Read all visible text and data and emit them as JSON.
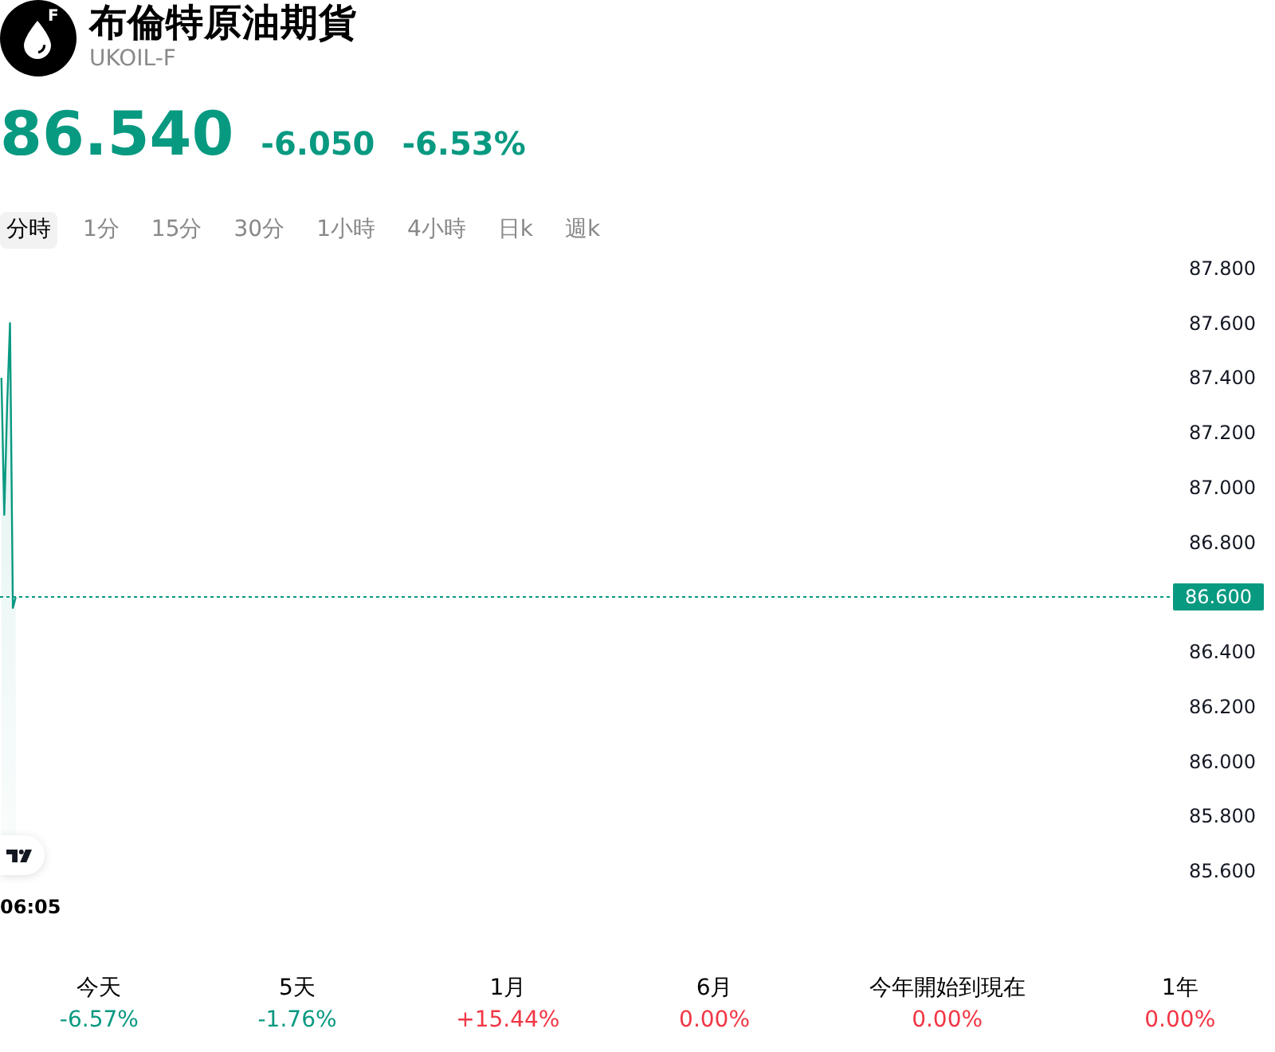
{
  "header": {
    "logo_letter": "F",
    "title": "布倫特原油期貨",
    "symbol": "UKOIL-F"
  },
  "quote": {
    "price": "86.540",
    "change": "-6.050",
    "change_percent": "-6.53%",
    "color": "#089981"
  },
  "tabs": [
    {
      "label": "分時",
      "selected": true
    },
    {
      "label": "1分",
      "selected": false
    },
    {
      "label": "15分",
      "selected": false
    },
    {
      "label": "30分",
      "selected": false
    },
    {
      "label": "1小時",
      "selected": false
    },
    {
      "label": "4小時",
      "selected": false
    },
    {
      "label": "日k",
      "selected": false
    },
    {
      "label": "週k",
      "selected": false
    }
  ],
  "chart": {
    "chart_data": {
      "type": "area",
      "categories": [
        null,
        null,
        null,
        null,
        null,
        null,
        null,
        null,
        null,
        null,
        null,
        null,
        null,
        null,
        null,
        null,
        null,
        null,
        null,
        null,
        null,
        null,
        null,
        null,
        null,
        null,
        null,
        null,
        null,
        null,
        null,
        null,
        null,
        null,
        null,
        null,
        null,
        null,
        null,
        null,
        null,
        null,
        null,
        null,
        null,
        null,
        null,
        null,
        null,
        null,
        null,
        null,
        null,
        null,
        null,
        null,
        null,
        null,
        null,
        null,
        null,
        null,
        null,
        null,
        null,
        null,
        null,
        null,
        null,
        null,
        null,
        null,
        null,
        null,
        null,
        null,
        null,
        null,
        null,
        null,
        null,
        null,
        null,
        null,
        null,
        null,
        null,
        null,
        null,
        null,
        null,
        null,
        null,
        null,
        null,
        null,
        null,
        null,
        null,
        null,
        null,
        null,
        null,
        null,
        null,
        null,
        null,
        null,
        null,
        null,
        null,
        null,
        null,
        null,
        null,
        null,
        null,
        null,
        null,
        null,
        null,
        null,
        null,
        null,
        null,
        null,
        null,
        null,
        null,
        null,
        null,
        null,
        null,
        null,
        null,
        null,
        null,
        null,
        null,
        null,
        null,
        null,
        null,
        null,
        null,
        null,
        null,
        null,
        null,
        null,
        null,
        null,
        null,
        null,
        null,
        null,
        null,
        null,
        null,
        null,
        null,
        null,
        null,
        null,
        null,
        null,
        null,
        null,
        null,
        null,
        null,
        null,
        null,
        null,
        null,
        null,
        null,
        null,
        null,
        null,
        null,
        null,
        null,
        null,
        null,
        null,
        null,
        null,
        null,
        null,
        null,
        null,
        null,
        null,
        null,
        null,
        null,
        null,
        null,
        null,
        null,
        null,
        null,
        null,
        null,
        null,
        null,
        null,
        null,
        null,
        null,
        null,
        null,
        null,
        null,
        null,
        null,
        null,
        null,
        null,
        null,
        null,
        null,
        null,
        null,
        null,
        null,
        null,
        null,
        null,
        null,
        null,
        null,
        null,
        null,
        null,
        null,
        null,
        null,
        null,
        null,
        null,
        null,
        null,
        null,
        null,
        null,
        null,
        null,
        null,
        null,
        null,
        null,
        null,
        null,
        null,
        null,
        null,
        null,
        null,
        null,
        null,
        null,
        null,
        null,
        null,
        null,
        null,
        null,
        null,
        null,
        null,
        null,
        null,
        null,
        null,
        null,
        null,
        null,
        null,
        null,
        null,
        null,
        null,
        null,
        null,
        null,
        null,
        null,
        null,
        null,
        null,
        null,
        null,
        null,
        null,
        null,
        null,
        null,
        null,
        null,
        null,
        null,
        null,
        null,
        null,
        null,
        null,
        null,
        null,
        null,
        null,
        null,
        null,
        null,
        null,
        null,
        null,
        null,
        null,
        null,
        null,
        null,
        null,
        null,
        null,
        null,
        null,
        null,
        null,
        null,
        null,
        null,
        null,
        null,
        null,
        null,
        null,
        null,
        null,
        null,
        null,
        null,
        null,
        null,
        null,
        null,
        null,
        null,
        null,
        null,
        null,
        null,
        null,
        null,
        null,
        null,
        null,
        null,
        null,
        null,
        null,
        null,
        null,
        null,
        null,
        null,
        null,
        null,
        null,
        null,
        null,
        null,
        null,
        null,
        null,
        null,
        null,
        null,
        null,
        null,
        null,
        null,
        null,
        null,
        null,
        null,
        null,
        null,
        null,
        null,
        null,
        null,
        null,
        null,
        null,
        null,
        null,
        null,
        null,
        null,
        null,
        null,
        null,
        null,
        null,
        null,
        null,
        null,
        null
      ],
      "ylim": [
        85.6,
        87.8
      ],
      "series": [
        {
          "color": "#089981",
          "values": [
            87.4,
            86.9,
            87.3,
            87.6,
            86.56,
            86.6,
            null,
            null,
            null,
            null,
            null,
            null,
            null,
            null,
            null,
            null,
            null,
            null,
            null,
            null,
            null,
            null,
            null,
            null,
            null,
            null,
            null,
            null,
            null,
            null,
            null,
            null,
            null,
            null,
            null,
            null,
            null,
            null,
            null,
            null,
            null,
            null,
            null,
            null,
            null,
            null,
            null,
            null,
            null,
            null,
            null,
            null,
            null,
            null,
            null,
            null,
            null,
            null,
            null,
            null,
            null,
            null,
            null,
            null,
            null,
            null,
            null,
            null,
            null,
            null,
            null,
            null,
            null,
            null,
            null,
            null,
            null,
            null,
            null,
            null,
            null,
            null,
            null,
            null,
            null,
            null,
            null,
            null,
            null,
            null,
            null,
            null,
            null,
            null,
            null,
            null,
            null,
            null,
            null,
            null,
            null,
            null,
            null,
            null,
            null,
            null,
            null,
            null,
            null,
            null,
            null,
            null,
            null,
            null,
            null,
            null,
            null,
            null,
            null,
            null,
            null,
            null,
            null,
            null,
            null,
            null,
            null,
            null,
            null,
            null,
            null,
            null,
            null,
            null,
            null,
            null,
            null,
            null,
            null,
            null,
            null,
            null,
            null,
            null,
            null,
            null,
            null,
            null,
            null,
            null,
            null,
            null,
            null,
            null,
            null,
            null,
            null,
            null,
            null,
            null,
            null,
            null,
            null,
            null,
            null,
            null,
            null,
            null,
            null,
            null,
            null,
            null,
            null,
            null,
            null,
            null,
            null,
            null,
            null,
            null,
            null,
            null,
            null,
            null,
            null,
            null,
            null,
            null,
            null,
            null,
            null,
            null,
            null,
            null,
            null,
            null,
            null,
            null,
            null,
            null,
            null,
            null,
            null,
            null,
            null,
            null,
            null,
            null,
            null,
            null,
            null,
            null,
            null,
            null,
            null,
            null,
            null,
            null,
            null,
            null,
            null,
            null,
            null,
            null,
            null,
            null,
            null,
            null,
            null,
            null,
            null,
            null,
            null,
            null,
            null,
            null,
            null,
            null,
            null,
            null,
            null,
            null,
            null,
            null,
            null,
            null,
            null,
            null,
            null,
            null,
            null,
            null,
            null,
            null,
            null,
            null,
            null,
            null,
            null,
            null,
            null,
            null,
            null,
            null,
            null,
            null,
            null,
            null,
            null,
            null,
            null,
            null,
            null,
            null,
            null,
            null,
            null,
            null,
            null,
            null,
            null,
            null,
            null,
            null,
            null,
            null,
            null,
            null,
            null,
            null,
            null,
            null,
            null,
            null,
            null,
            null,
            null,
            null,
            null,
            null,
            null,
            null,
            null,
            null,
            null,
            null,
            null,
            null,
            null,
            null,
            null,
            null,
            null,
            null,
            null,
            null,
            null,
            null,
            null,
            null,
            null,
            null,
            null,
            null,
            null,
            null,
            null,
            null,
            null,
            null,
            null,
            null,
            null,
            null,
            null,
            null,
            null,
            null,
            null,
            null,
            null,
            null,
            null,
            null,
            null,
            null,
            null,
            null,
            null,
            null,
            null,
            null,
            null,
            null,
            null,
            null,
            null,
            null,
            null,
            null,
            null,
            null,
            null,
            null,
            null,
            null,
            null,
            null,
            null,
            null,
            null,
            null,
            null,
            null,
            null,
            null,
            null,
            null,
            null,
            null,
            null,
            null,
            null,
            null,
            null,
            null,
            null,
            null,
            null,
            null,
            null,
            null,
            null,
            null,
            null,
            null,
            null,
            null,
            null,
            null,
            null,
            null,
            null,
            null,
            null,
            null,
            null,
            null,
            null,
            null
          ]
        }
      ],
      "yticks": [
        {
          "value": 87.8,
          "label": "87.800"
        },
        {
          "value": 87.6,
          "label": "87.600"
        },
        {
          "value": 87.4,
          "label": "87.400"
        },
        {
          "value": 87.2,
          "label": "87.200"
        },
        {
          "value": 87.0,
          "label": "87.000"
        },
        {
          "value": 86.8,
          "label": "86.800"
        },
        {
          "value": 86.4,
          "label": "86.400"
        },
        {
          "value": 86.2,
          "label": "86.200"
        },
        {
          "value": 86.0,
          "label": "86.000"
        },
        {
          "value": 85.8,
          "label": "85.800"
        },
        {
          "value": 85.6,
          "label": "85.600"
        }
      ],
      "ref_lines": [
        {
          "axis": "y",
          "value": 86.6,
          "label": "86.600"
        }
      ],
      "annotations": [
        "06:05"
      ]
    }
  },
  "performance": [
    {
      "label": "今天",
      "value": "-6.57%",
      "color": "#089981"
    },
    {
      "label": "5天",
      "value": "-1.76%",
      "color": "#089981"
    },
    {
      "label": "1月",
      "value": "+15.44%",
      "color": "#f23645"
    },
    {
      "label": "6月",
      "value": "0.00%",
      "color": "#f23645"
    },
    {
      "label": "今年開始到現在",
      "value": "0.00%",
      "color": "#f23645"
    },
    {
      "label": "1年",
      "value": "0.00%",
      "color": "#f23645"
    }
  ]
}
